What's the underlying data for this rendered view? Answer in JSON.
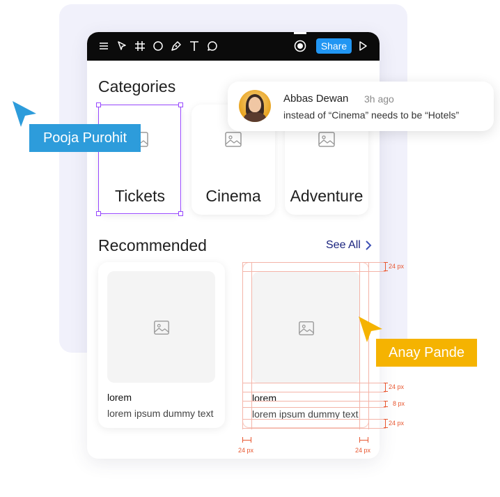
{
  "toolbar": {
    "icons": [
      "menu-icon",
      "pointer-icon",
      "frame-icon",
      "circle-icon",
      "pen-icon",
      "text-icon",
      "comment-icon",
      "record-icon",
      "play-icon"
    ],
    "share_label": "Share"
  },
  "categories": {
    "title": "Categories",
    "items": [
      {
        "label": "Tickets"
      },
      {
        "label": "Cinema"
      },
      {
        "label": "Adventure"
      }
    ]
  },
  "recommended": {
    "title": "Recommended",
    "see_all": "See All",
    "items": [
      {
        "name": "lorem",
        "desc": "lorem ipsum dummy text"
      },
      {
        "name": "lorem",
        "desc": "lorem ipsum dummy text"
      }
    ]
  },
  "specs": {
    "top": "24 px",
    "image_gap": "24 px",
    "text_gap": "8 px",
    "bottom": "24 px",
    "left": "24 px",
    "right": "24 px"
  },
  "comment": {
    "author": "Abbas Dewan",
    "time": "3h ago",
    "text": "instead of “Cinema” needs to be “Hotels”"
  },
  "collaborators": [
    {
      "name": "Pooja Purohit",
      "color": "#2d9cdb"
    },
    {
      "name": "Anay Pande",
      "color": "#f5b301"
    }
  ],
  "colors": {
    "accent": "#2196f3",
    "selection": "#9747ff",
    "spec": "#e8562f"
  }
}
